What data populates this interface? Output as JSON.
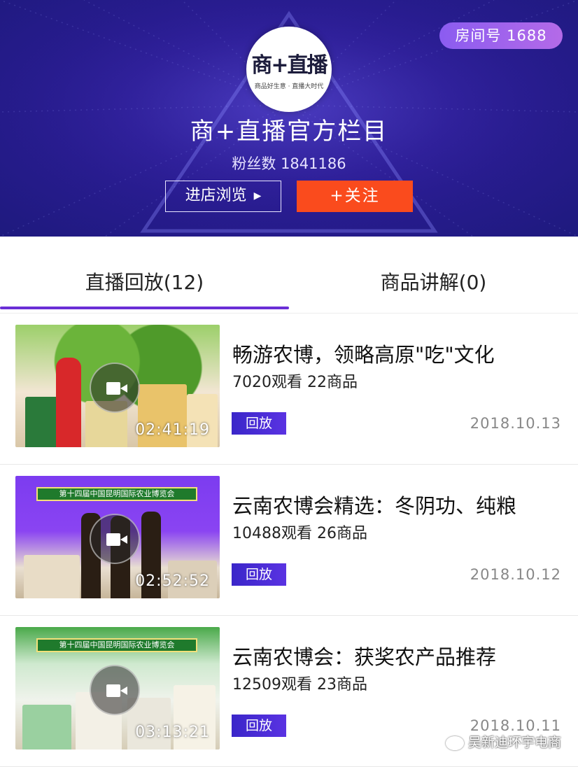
{
  "header": {
    "room_badge": "房间号 1688",
    "logo_text": "商+直播",
    "logo_subtext": "商品好生意 · 直播大时代",
    "store_title": "商+直播官方栏目",
    "fans": "粉丝数 1841186",
    "enter_store_label": "进店浏览",
    "enter_store_arrow": "▶",
    "follow_label": "+关注",
    "colors": {
      "banner": "#2c1c96",
      "follow": "#fa4b1d",
      "accent": "#6a2fd6"
    }
  },
  "tabs": [
    {
      "label": "直播回放(12)",
      "active": true
    },
    {
      "label": "商品讲解(0)",
      "active": false
    }
  ],
  "items": [
    {
      "duration": "02:41:19",
      "title": "畅游农博，领略高原\"吃\"文化",
      "meta": "7020观看  22商品",
      "replay_label": "回放",
      "date": "2018.10.13",
      "icon": "video-camera-icon"
    },
    {
      "duration": "02:52:52",
      "title": "云南农博会精选：冬阴功、纯粮",
      "meta": "10488观看  26商品",
      "replay_label": "回放",
      "date": "2018.10.12",
      "banner_text": "第十四届中国昆明国际农业博览会",
      "icon": "video-camera-icon"
    },
    {
      "duration": "03:13:21",
      "title": "云南农博会：获奖农产品推荐",
      "meta": "12509观看  23商品",
      "replay_label": "回放",
      "date": "2018.10.11",
      "banner_text": "第十四届中国昆明国际农业博览会",
      "icon": "video-camera-icon"
    }
  ],
  "watermark": "吴新迪环宇电商"
}
